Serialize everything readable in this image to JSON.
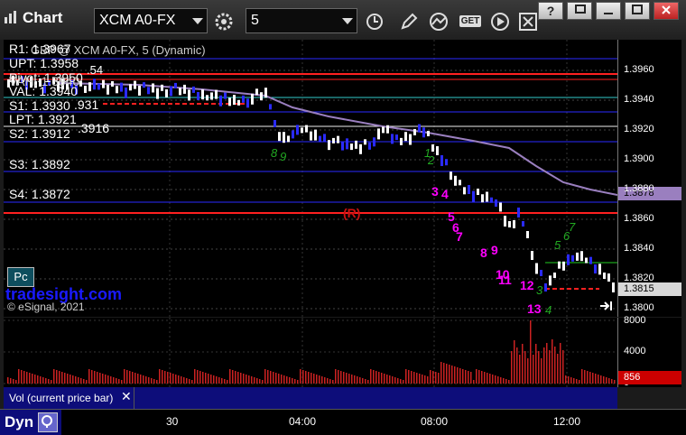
{
  "app": {
    "title": "Chart"
  },
  "toolbar": {
    "symbol": "XCM A0-FX",
    "interval": "5",
    "get_label": "GET"
  },
  "chart": {
    "header": "GBP @ XCM A0-FX, 5 (Dynamic)",
    "levels": {
      "r1": "R1: 1.3967",
      "upt": "UPT: 1.3958",
      "upt_extra": ".54",
      "pivot": "Pivot: 1.3950",
      "vah": "VAH: 1.3940",
      "val": "VAL: 1.3940",
      "s1": "S1: 1.3930",
      "s1_extra": ".931",
      "lpt": "LPT: 1.3921",
      "s2": "S2: 1.3912",
      "s2_extra": ".3916",
      "s3": "S3: 1.3892",
      "s4": "S4: 1.3872"
    },
    "r_marker": "(R)",
    "seq_labels": [
      "3",
      "4",
      "5",
      "6",
      "7",
      "8",
      "9",
      "10",
      "11",
      "12",
      "13"
    ],
    "green_counts": [
      "8",
      "9",
      "1",
      "2",
      "3",
      "4",
      "5",
      "6",
      "7"
    ],
    "brand_box": "Pc",
    "brand": "tradesight.com",
    "copyright": "© eSignal, 2021"
  },
  "price_axis": {
    "ticks": [
      "1.3960",
      "1.3940",
      "1.3920",
      "1.3900",
      "1.3880",
      "1.3860",
      "1.3840",
      "1.3820",
      "1.3800"
    ],
    "tag_purple": "1.3878",
    "tag_current": "1.3815"
  },
  "volume": {
    "label": "Vol (current price bar)",
    "ticks": [
      "8000",
      "4000",
      "0"
    ],
    "tag": "856"
  },
  "time_axis": {
    "ticks": [
      "30",
      "04:00",
      "08:00",
      "12:00"
    ]
  },
  "bottom": {
    "label": "Dyn"
  },
  "colors": {
    "accent_blue": "#1a1aff",
    "magenta": "#ff00ff",
    "red_line": "#ff2020",
    "purple_ma": "#9a7fbf",
    "green_count": "#22aa22"
  }
}
